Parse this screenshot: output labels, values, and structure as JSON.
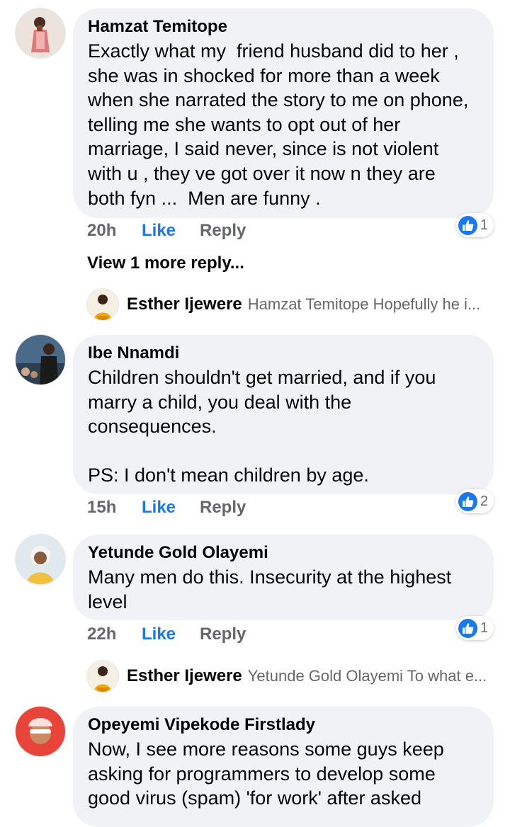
{
  "comments": [
    {
      "author": "Hamzat Temitope",
      "text": "Exactly what my  friend husband did to her ,\nshe was in shocked for more than a week\nwhen she narrated the story to me on phone,\ntelling me she wants to opt out of her\nmarriage, I said never, since is not violent\nwith u , they ve got over it now n they are\nboth fyn ...  Men are funny .",
      "time": "20h",
      "like_label": "Like",
      "reply_label": "Reply",
      "reaction_count": "1",
      "view_more": "View 1 more reply...",
      "reply_preview": {
        "name": "Esther Ijewere",
        "text": "Hamzat Temitope Hopefully he i..."
      }
    },
    {
      "author": "Ibe Nnamdi",
      "text": "Children shouldn't get married, and if you\nmarry a child, you deal with the\nconsequences.\n\nPS: I don't mean children by age.",
      "time": "15h",
      "like_label": "Like",
      "reply_label": "Reply",
      "reaction_count": "2"
    },
    {
      "author": "Yetunde Gold Olayemi",
      "text": "Many men do this. Insecurity at the highest\nlevel",
      "time": "22h",
      "like_label": "Like",
      "reply_label": "Reply",
      "reaction_count": "1",
      "reply_preview": {
        "name": "Esther Ijewere",
        "text": "Yetunde Gold Olayemi To what e..."
      }
    },
    {
      "author": "Opeyemi Vipekode Firstlady",
      "text": "Now, I see more reasons some guys keep\nasking for programmers to develop some\ngood virus (spam) 'for work' after asked"
    }
  ],
  "icons": {
    "reaction": "like-thumbs-up-icon",
    "avatar": "profile-photo"
  },
  "colors": {
    "like": "#1877f2",
    "bubble": "#f0f2f5",
    "meta": "#65676b"
  }
}
